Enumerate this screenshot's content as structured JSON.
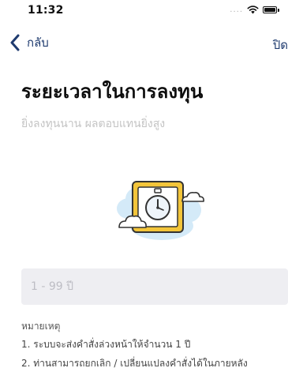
{
  "status_bar": {
    "time": "11:32",
    "signal_dots": "....",
    "icons": [
      "wifi-icon",
      "battery-icon"
    ]
  },
  "nav": {
    "back_label": "กลับ",
    "close_label": "ปิด",
    "accent_color": "#1f3b6f"
  },
  "header": {
    "title": "ระยะเวลาในการลงทุน",
    "subtitle": "ยิ่งลงทุนนาน ผลตอบแทนยิ่งสูง"
  },
  "illustration": {
    "icon": "stopwatch-icon",
    "frame_color": "#f1c232",
    "cloud_color": "#cfe7f7"
  },
  "duration_input": {
    "value": "",
    "placeholder": "1 - 99 ปี"
  },
  "notes": {
    "title": "หมายเหตุ",
    "items": [
      "1. ระบบจะส่งคำสั่งล่วงหน้าให้จำนวน 1 ปี",
      "2. ท่านสามารถยกเลิก / เปลี่ยนแปลงคำสั่งได้ในภายหลัง"
    ]
  }
}
